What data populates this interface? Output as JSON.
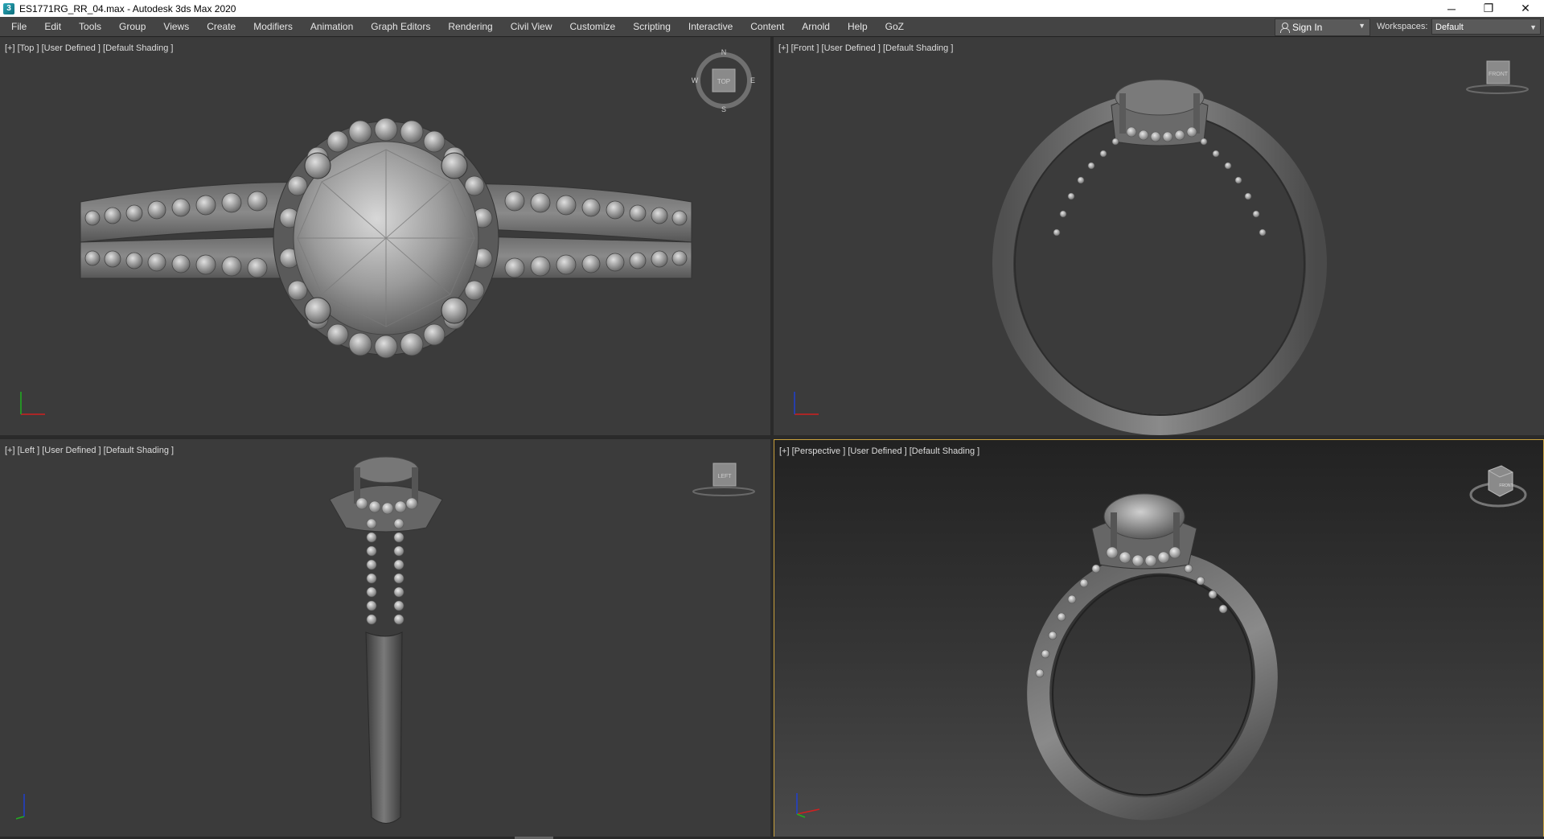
{
  "window": {
    "title": "ES1771RG_RR_04.max - Autodesk 3ds Max 2020",
    "app_icon_glyph": "3",
    "controls": {
      "minimize": "─",
      "maximize": "❐",
      "close": "✕"
    }
  },
  "menubar": {
    "items": [
      "File",
      "Edit",
      "Tools",
      "Group",
      "Views",
      "Create",
      "Modifiers",
      "Animation",
      "Graph Editors",
      "Rendering",
      "Civil View",
      "Customize",
      "Scripting",
      "Interactive",
      "Content",
      "Arnold",
      "Help",
      "GoZ"
    ],
    "sign_in_label": "Sign In",
    "workspaces_label": "Workspaces:",
    "workspace_value": "Default"
  },
  "viewports": {
    "top": {
      "plus": "[+]",
      "view": "[Top ]",
      "mode": "[User Defined ]",
      "shading": "[Default Shading ]",
      "cube_label": "TOP",
      "compass": {
        "n": "N",
        "s": "S",
        "e": "E",
        "w": "W"
      }
    },
    "front": {
      "plus": "[+]",
      "view": "[Front ]",
      "mode": "[User Defined ]",
      "shading": "[Default Shading ]",
      "cube_label": "FRONT"
    },
    "left": {
      "plus": "[+]",
      "view": "[Left ]",
      "mode": "[User Defined ]",
      "shading": "[Default Shading ]",
      "cube_label": "LEFT"
    },
    "persp": {
      "plus": "[+]",
      "view": "[Perspective ]",
      "mode": "[User Defined ]",
      "shading": "[Default Shading ]",
      "cube_label": "FRONT"
    }
  },
  "colors": {
    "viewport_bg": "#3b3b3b",
    "active_border": "#c8a03c",
    "menubar_bg": "#444444",
    "axis_x": "#d02020",
    "axis_y": "#20b020",
    "axis_z": "#2040d0"
  }
}
